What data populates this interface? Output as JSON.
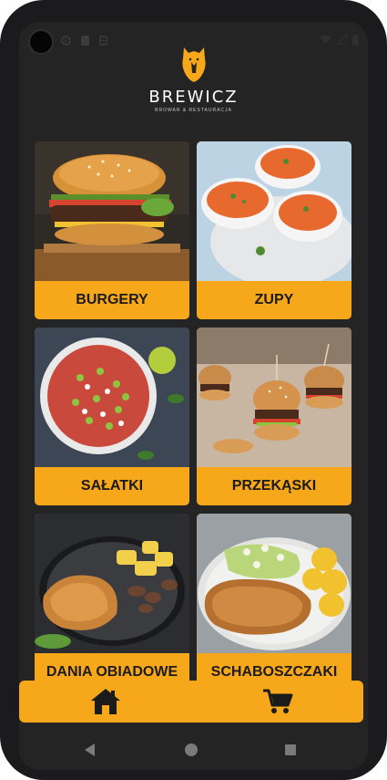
{
  "app": {
    "name": "BREWICZ",
    "tagline": "BROWAR & RESTAURACJA"
  },
  "categories": [
    {
      "label": "BURGERY"
    },
    {
      "label": "ZUPY"
    },
    {
      "label": "SAŁATKI"
    },
    {
      "label": "PRZEKĄSKI"
    },
    {
      "label": "DANIA OBIADOWE"
    },
    {
      "label": "SCHABOSZCZAKI"
    }
  ],
  "bottom_nav": {
    "items": [
      {
        "icon": "home-icon"
      },
      {
        "icon": "cart-icon"
      }
    ]
  },
  "colors": {
    "accent": "#f7a81a",
    "background": "#242424"
  }
}
